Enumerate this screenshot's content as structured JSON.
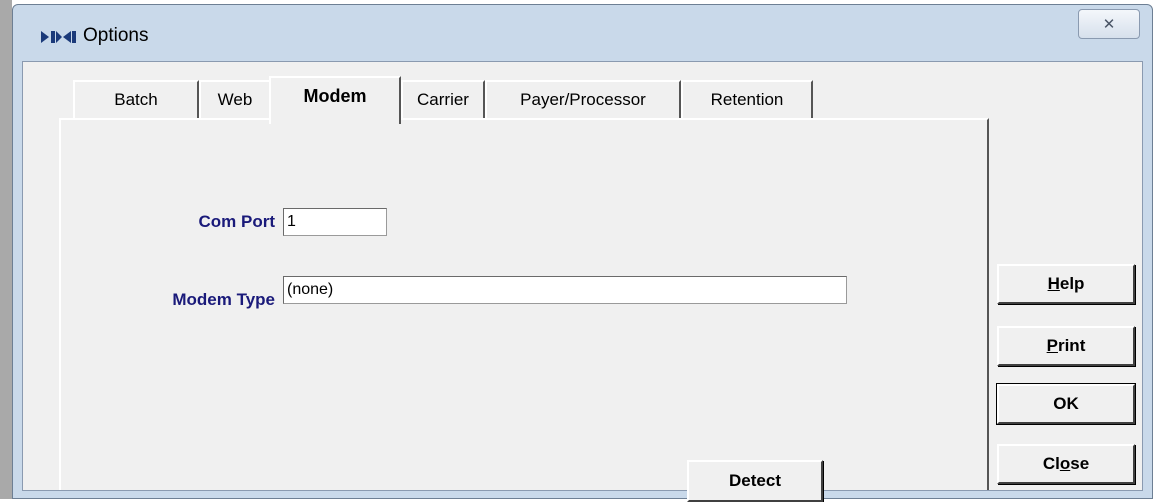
{
  "window": {
    "title": "Options",
    "close_glyph": "✕"
  },
  "tabs": [
    {
      "label": "Batch",
      "active": false
    },
    {
      "label": "Web",
      "active": false
    },
    {
      "label": "Modem",
      "active": true
    },
    {
      "label": "Carrier",
      "active": false
    },
    {
      "label": "Payer/Processor",
      "active": false
    },
    {
      "label": "Retention",
      "active": false
    }
  ],
  "modem": {
    "com_port_label": "Com Port",
    "com_port_value": "1",
    "modem_type_label": "Modem Type",
    "modem_type_value": "(none)",
    "detect_button": "Detect"
  },
  "side_buttons": {
    "help": {
      "pre": "",
      "mnemonic": "H",
      "post": "elp"
    },
    "print": {
      "pre": "",
      "mnemonic": "P",
      "post": "rint"
    },
    "ok": {
      "pre": "OK",
      "mnemonic": "",
      "post": ""
    },
    "close": {
      "pre": "Cl",
      "mnemonic": "o",
      "post": "se"
    }
  },
  "icons": {
    "app": "app-logo-icon",
    "close": "close-icon"
  },
  "colors": {
    "label_blue": "#1a1a7a",
    "dialog_face": "#f0f0f0",
    "title_frame": "#c9d9ea"
  }
}
